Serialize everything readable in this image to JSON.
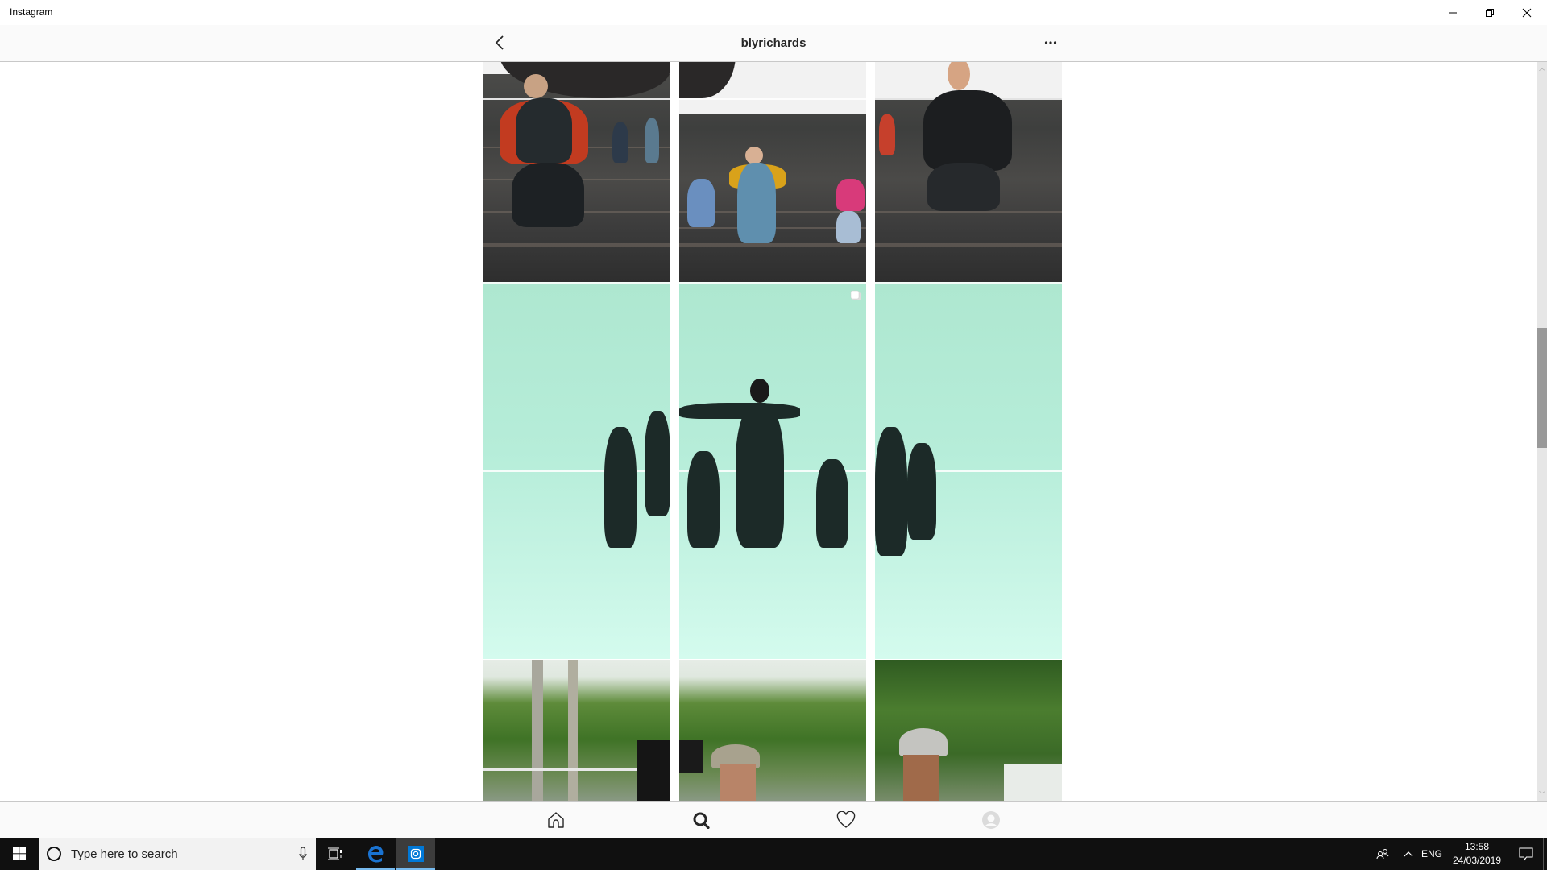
{
  "window": {
    "title": "Instagram",
    "controls": [
      {
        "name": "minimize",
        "icon": "minimize-icon"
      },
      {
        "name": "restore",
        "icon": "restore-icon"
      },
      {
        "name": "close",
        "icon": "close-icon"
      }
    ]
  },
  "header": {
    "back_icon": "chevron-left-icon",
    "username": "blyrichards",
    "more_icon": "ellipsis-icon",
    "more_label": "•••"
  },
  "grid": {
    "rows": [
      {
        "description": "Dancers jumping on stone stairs (3-part panorama)",
        "tiles": [
          {
            "subject": "Man in orange shirt and black vest jumping",
            "multi": false
          },
          {
            "subject": "Girl in denim overalls jumping, group behind",
            "multi": true
          },
          {
            "subject": "Woman in black jacket jumping",
            "multi": false
          }
        ]
      },
      {
        "description": "Dancers in black on mint green background (3-part panorama)",
        "tiles": [
          {
            "subject": "Left dancers mint background",
            "multi": false
          },
          {
            "subject": "Lead dancer center mint background",
            "multi": true
          },
          {
            "subject": "Right dancers mint background",
            "multi": false
          }
        ]
      },
      {
        "description": "Outdoor park filming crew",
        "tiles": [
          {
            "subject": "Trees and camera rig",
            "multi": false
          },
          {
            "subject": "Man in grey cap behind camera",
            "multi": false
          },
          {
            "subject": "Man in patterned cap",
            "multi": false
          }
        ]
      }
    ]
  },
  "bottom_nav": [
    {
      "name": "home",
      "icon": "home-icon",
      "active": false
    },
    {
      "name": "search",
      "icon": "search-icon",
      "active": true
    },
    {
      "name": "activity",
      "icon": "heart-icon",
      "active": false
    },
    {
      "name": "profile",
      "icon": "profile-avatar-icon",
      "active": false
    }
  ],
  "scroll": {
    "position_fraction": 0.36
  },
  "taskbar": {
    "search_placeholder": "Type here to search",
    "apps": [
      {
        "name": "task-view",
        "icon": "task-view-icon"
      },
      {
        "name": "edge",
        "icon": "edge-icon",
        "running": true
      },
      {
        "name": "instagram",
        "icon": "instagram-icon",
        "running": true,
        "active": true
      }
    ],
    "tray": {
      "language": "ENG",
      "time": "13:58",
      "date": "24/03/2019"
    }
  },
  "colors": {
    "taskbar_bg": "#101010",
    "accent_blue": "#0078d7",
    "edge_blue": "#1a73d1",
    "mint": "#b6edd9"
  }
}
